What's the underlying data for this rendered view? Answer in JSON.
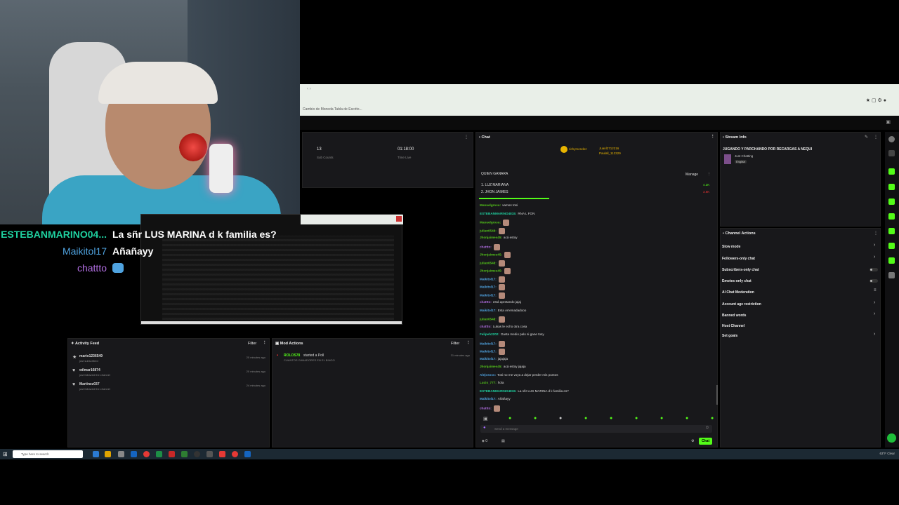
{
  "overlay_chat": [
    {
      "name": "ESTEBANMARINO04...",
      "name_color": "#1fd1a0",
      "message": "La sñr LUS MARINA d k familia es?"
    },
    {
      "name": "Maikitol17",
      "name_color": "#4fa3e0",
      "message": "Añañayy"
    },
    {
      "name": "chattto",
      "name_color": "#b06de0",
      "message": ""
    }
  ],
  "bookmarks": "Cambio de Moneda   Tabla de Escrito...",
  "stats": {
    "sub_counts_value": "13",
    "sub_counts_label": "Sub Counts",
    "time_live_value": "01:18:00",
    "time_live_label": "Time Live"
  },
  "activity_feed": {
    "title": "Activity Feed",
    "filter": "Filter",
    "items": [
      {
        "icon": "star-icon",
        "name": "mario1236549",
        "desc": "just subscribed",
        "time": "20 minutes ago"
      },
      {
        "icon": "heart-icon",
        "name": "wilmar16874",
        "desc": "just followed the channel",
        "time": "20 minutes ago"
      },
      {
        "icon": "heart-icon",
        "name": "Martinez037",
        "desc": "just followed the channel",
        "time": "24 minutes ago"
      }
    ]
  },
  "mod_actions": {
    "title": "Mod Actions",
    "filter": "Filter",
    "item_user": "ROLOS78",
    "item_action": "started a Poll",
    "item_desc": "CUANTOS GANADORES EN EL BINGO",
    "item_time": "31 minutes ago"
  },
  "chat": {
    "title": "Chat",
    "pinned_users": [
      "richymendez",
      "Juanl2712216",
      "Paulall_112329"
    ],
    "poll_title": "QUIEN GANARA",
    "manage": "Manage",
    "poll_options": [
      {
        "label": "1. LUZ MARIANA",
        "value": "4.2K"
      },
      {
        "label": "2. JHON JAIMES",
        "value": "3.6K"
      }
    ],
    "messages": [
      {
        "user": "Manuelgrosu:",
        "color": "#53c41a",
        "text": "vamos tosi"
      },
      {
        "user": "ESTEBANMARINO4815:",
        "color": "#1fd1a0",
        "text": "RNA L FON"
      },
      {
        "user": "Manuelgrosu:",
        "color": "#53c41a",
        "text": ""
      },
      {
        "user": "julian0548:",
        "color": "#53c41a",
        "text": ""
      },
      {
        "user": "Jhonjaimes45:",
        "color": "#53c41a",
        "text": "acá estoy"
      },
      {
        "user": "chattto:",
        "color": "#b06de0",
        "text": ""
      },
      {
        "user": "Jhonjaimes45:",
        "color": "#53c41a",
        "text": ""
      },
      {
        "user": "julian0548:",
        "color": "#53c41a",
        "text": ""
      },
      {
        "user": "Jhonjaimes45:",
        "color": "#53c41a",
        "text": ""
      },
      {
        "user": "Maikitol17:",
        "color": "#4fa3e0",
        "text": ""
      },
      {
        "user": "Maikitol17:",
        "color": "#4fa3e0",
        "text": ""
      },
      {
        "user": "Maikitol17:",
        "color": "#4fa3e0",
        "text": ""
      },
      {
        "user": "chattto:",
        "color": "#b06de0",
        "text": "está apretando jajaj"
      },
      {
        "user": "Maikitol17:",
        "color": "#4fa3e0",
        "text": "Esta Arremadadooo"
      },
      {
        "user": "julian0548:",
        "color": "#53c41a",
        "text": ""
      },
      {
        "user": "chattto:",
        "color": "#b06de0",
        "text": "Lukas le echo otra cosa"
      },
      {
        "user": "Felipeh2202:",
        "color": "#1fd1a0",
        "text": "Gasta medio palo si gane tosy"
      },
      {
        "user": "Maikitol17:",
        "color": "#4fa3e0",
        "text": ""
      },
      {
        "user": "Maikitol17:",
        "color": "#4fa3e0",
        "text": ""
      },
      {
        "user": "Maikitol17:",
        "color": "#4fa3e0",
        "text": "jajajaja"
      },
      {
        "user": "Jhonjaimes45:",
        "color": "#53c41a",
        "text": "acá estoy jajaja"
      },
      {
        "user": "Alejossss:",
        "color": "#4fa3e0",
        "text": "Tosi no me voya a dejar perder mis puntos"
      },
      {
        "user": "Lucis_777:",
        "color": "#53c41a",
        "text": "hola"
      },
      {
        "user": "ESTEBANMARINO4815:",
        "color": "#1fd1a0",
        "text": "La sñr LUS MARINA d k familia es?"
      },
      {
        "user": "Maikitol17:",
        "color": "#4fa3e0",
        "text": "Añañayy"
      },
      {
        "user": "chattto:",
        "color": "#b06de0",
        "text": ""
      }
    ],
    "input_placeholder": "Send a message",
    "points": "0",
    "send_label": "Chat"
  },
  "stream_info": {
    "title": "Stream Info",
    "stream_title": "JUGANDO Y PARCHANDO POR RECARGAS A NEQUI",
    "category": "Just Chatting",
    "language": "English"
  },
  "channel_actions": {
    "title": "Channel Actions",
    "items": [
      {
        "label": "Slow mode",
        "control": "chevron"
      },
      {
        "label": "Followers-only chat",
        "control": "chevron"
      },
      {
        "label": "Subscribers-only chat",
        "control": "toggle"
      },
      {
        "label": "Emotes-only chat",
        "control": "toggle"
      },
      {
        "label": "AI Chat Moderation",
        "control": "settings"
      },
      {
        "label": "Account age restriction",
        "control": "chevron"
      },
      {
        "label": "Banned words",
        "control": "chevron"
      },
      {
        "label": "Host Channel",
        "control": "none"
      },
      {
        "label": "Set goals",
        "control": "chevron"
      }
    ]
  },
  "taskbar": {
    "search_placeholder": "Type here to search",
    "tray_text": "63°F Clear"
  },
  "colors": {
    "kick_green": "#53fc18",
    "panel_bg": "#18181b",
    "browser_bar": "#e9efe8"
  }
}
